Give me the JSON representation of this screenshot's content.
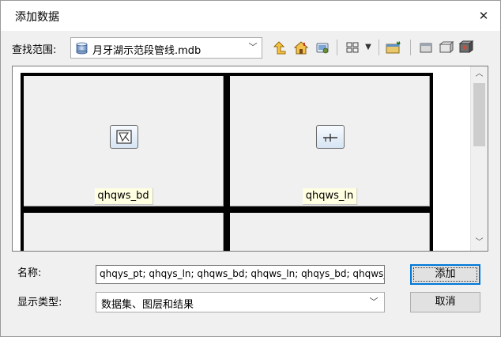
{
  "window": {
    "title": "添加数据",
    "close_glyph": "✕"
  },
  "toolbar": {
    "lookin_label": "查找范围:",
    "lookin_value": "月牙湖示范段管线.mdb",
    "icons": [
      "up-one-level-icon",
      "home-icon",
      "connect-folder-icon",
      "view-thumbnails-icon",
      "new-feature-dataset-icon",
      "catalog-icon",
      "toolbox-icon",
      "database-icon"
    ]
  },
  "browser": {
    "items": [
      {
        "label": "qhqws_bd",
        "icon": "polygon-feature-class-icon"
      },
      {
        "label": "qhqws_ln",
        "icon": "line-feature-class-icon"
      },
      {
        "label": "",
        "icon": ""
      },
      {
        "label": "",
        "icon": ""
      }
    ]
  },
  "form": {
    "name_label": "名称:",
    "name_value": "qhqys_pt; qhqys_ln; qhqws_bd; qhqws_ln; qhqys_bd; qhqws_pt",
    "type_label": "显示类型:",
    "type_value": "数据集、图层和结果"
  },
  "buttons": {
    "add_label": "添加",
    "cancel_label": "取消"
  },
  "colors": {
    "accent": "#0078d7",
    "tooltip_bg": "#ffffe1",
    "dialog_bg": "#f0f0f0"
  }
}
